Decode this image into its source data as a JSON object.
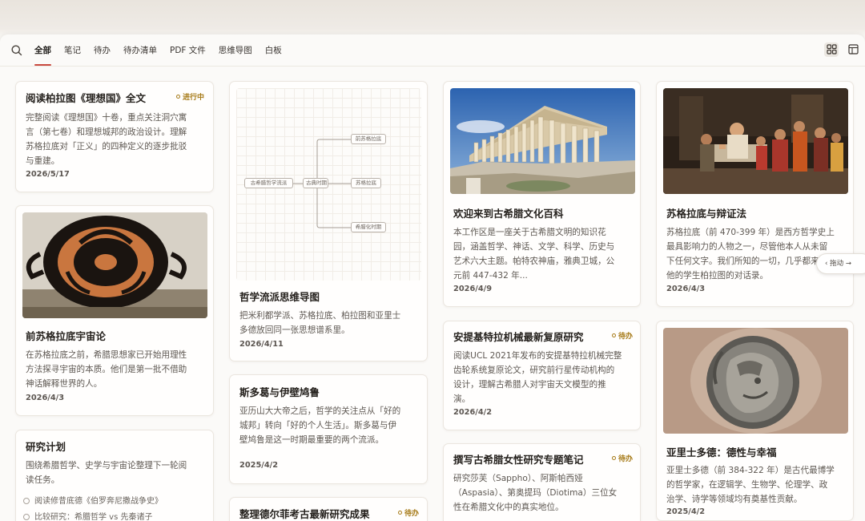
{
  "tabs": [
    "全部",
    "笔记",
    "待办",
    "待办清单",
    "PDF 文件",
    "思维导图",
    "白板"
  ],
  "active_tab": "全部",
  "accent_color": "#c94a3f",
  "badge_color": "#a67a17",
  "cards": {
    "republic": {
      "title": "阅读柏拉图《理想国》全文",
      "badge": "进行中",
      "body": [
        "完整阅读《理想国》十卷，重点关注洞穴寓",
        "言（第七卷）和理想城邦的政治设计。理解",
        "苏格拉底对「正义」的四种定义的逐步批驳",
        "与重建。"
      ],
      "date": "2026/5/17"
    },
    "presocratic": {
      "title": "前苏格拉底宇宙论",
      "body": [
        "在苏格拉底之前，希腊思想家已开始用理性",
        "方法探寻宇宙的本质。他们是第一批不借助",
        "神话解释世界的人。"
      ],
      "date": "2026/4/3"
    },
    "research": {
      "title": "研究计划",
      "body": [
        "围绕希腊哲学、史学与宇宙论整理下一轮阅",
        "读任务。"
      ],
      "tasks": [
        "阅读修昔底德《伯罗奔尼撒战争史》",
        "比较研究：希腊哲学 vs 先秦诸子"
      ]
    },
    "mindmap": {
      "title": "哲学流派思维导图",
      "body": [
        "把米利都学派、苏格拉底、柏拉图和亚里士",
        "多德放回同一张思想谱系里。"
      ],
      "date": "2026/4/11",
      "nodes": {
        "root": "古希腊哲学流派",
        "mid": "古典时期",
        "top": "前苏格拉底",
        "center": "苏格拉底",
        "bottom": "希腊化时期"
      }
    },
    "stoic": {
      "title": "斯多葛与伊壁鸠鲁",
      "body": [
        "亚历山大大帝之后，哲学的关注点从「好的",
        "城邦」转向「好的个人生活」。斯多葛与伊",
        "壁鸠鲁是这一时期最重要的两个流派。"
      ],
      "date": "2025/4/2"
    },
    "delphi": {
      "title": "整理德尔菲考古最新研究成果",
      "badge": "待办"
    },
    "welcome": {
      "title": "欢迎来到古希腊文化百科",
      "body": [
        "本工作区是一座关于古希腊文明的知识花",
        "园，涵盖哲学、神话、文学、科学、历史与",
        "艺术六大主题。帕特农神庙，雅典卫城，公",
        "元前 447-432 年..."
      ],
      "date": "2026/4/9"
    },
    "antikythera": {
      "title": "安提基特拉机械最新复原研究",
      "badge": "待办",
      "body": [
        "阅读UCL 2021年发布的安提基特拉机械完整",
        "齿轮系统复原论文，研究前行星传动机构的",
        "设计，理解古希腊人对宇宙天文模型的推",
        "演。"
      ],
      "date": "2026/4/2"
    },
    "women": {
      "title": "撰写古希腊女性研究专题笔记",
      "badge": "待办",
      "body": [
        "研究莎芙（Sappho）、阿斯帕西娅",
        "（Aspasia）、第奥提玛（Diotima）三位女",
        "性在希腊文化中的真实地位。"
      ]
    },
    "socrates": {
      "title": "苏格拉底与辩证法",
      "body": [
        "苏格拉底（前 470-399 年）是西方哲学史上",
        "最具影响力的人物之一，尽管他本人从未留",
        "下任何文字。我们所知的一切，几乎都来自",
        "他的学生柏拉图的对话录。"
      ],
      "date": "2026/4/3"
    },
    "aristotle": {
      "title": "亚里士多德：德性与幸福",
      "body": [
        "亚里士多德（前 384-322 年）是古代最博学",
        "的哲学家，在逻辑学、生物学、伦理学、政",
        "治学、诗学等领域均有奠基性贡献。"
      ],
      "date": "2025/4/2"
    }
  },
  "drag_pill": "拖动"
}
